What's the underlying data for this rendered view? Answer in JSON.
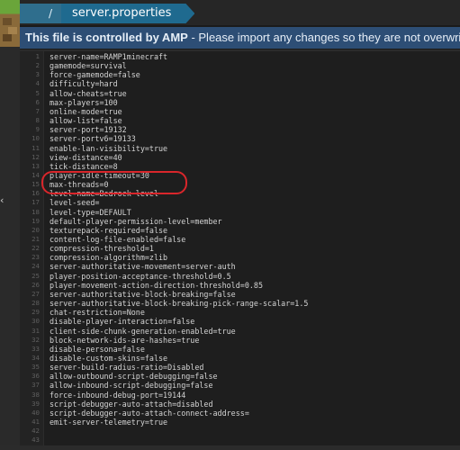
{
  "breadcrumb": {
    "separator": "/",
    "current": "server.properties"
  },
  "banner": {
    "bold_text": "This file is controlled by AMP",
    "rest_text": " - Please import any changes so they are not overwritten by AMP."
  },
  "editor": {
    "lines": [
      {
        "num": "1",
        "text": "server-name=RAMP1minecraft"
      },
      {
        "num": "2",
        "text": "gamemode=survival"
      },
      {
        "num": "3",
        "text": "force-gamemode=false"
      },
      {
        "num": "4",
        "text": "difficulty=hard"
      },
      {
        "num": "5",
        "text": "allow-cheats=true"
      },
      {
        "num": "6",
        "text": "max-players=100"
      },
      {
        "num": "7",
        "text": "online-mode=true"
      },
      {
        "num": "8",
        "text": "allow-list=false"
      },
      {
        "num": "9",
        "text": "server-port=19132"
      },
      {
        "num": "10",
        "text": "server-portv6=19133"
      },
      {
        "num": "11",
        "text": "enable-lan-visibility=true"
      },
      {
        "num": "12",
        "text": "view-distance=40"
      },
      {
        "num": "13",
        "text": "tick-distance=8"
      },
      {
        "num": "14",
        "text": "player-idle-timeout=30"
      },
      {
        "num": "15",
        "text": "max-threads=0"
      },
      {
        "num": "16",
        "text": "level-name=Bedrock level"
      },
      {
        "num": "17",
        "text": "level-seed="
      },
      {
        "num": "18",
        "text": "level-type=DEFAULT"
      },
      {
        "num": "19",
        "text": "default-player-permission-level=member"
      },
      {
        "num": "20",
        "text": "texturepack-required=false"
      },
      {
        "num": "21",
        "text": "content-log-file-enabled=false"
      },
      {
        "num": "22",
        "text": "compression-threshold=1"
      },
      {
        "num": "23",
        "text": "compression-algorithm=zlib"
      },
      {
        "num": "24",
        "text": "server-authoritative-movement=server-auth"
      },
      {
        "num": "25",
        "text": "player-position-acceptance-threshold=0.5"
      },
      {
        "num": "26",
        "text": "player-movement-action-direction-threshold=0.85"
      },
      {
        "num": "27",
        "text": "server-authoritative-block-breaking=false"
      },
      {
        "num": "28",
        "text": "server-authoritative-block-breaking-pick-range-scalar=1.5"
      },
      {
        "num": "29",
        "text": "chat-restriction=None"
      },
      {
        "num": "30",
        "text": "disable-player-interaction=false"
      },
      {
        "num": "31",
        "text": "client-side-chunk-generation-enabled=true"
      },
      {
        "num": "32",
        "text": "block-network-ids-are-hashes=true"
      },
      {
        "num": "33",
        "text": "disable-persona=false"
      },
      {
        "num": "34",
        "text": "disable-custom-skins=false"
      },
      {
        "num": "35",
        "text": "server-build-radius-ratio=Disabled"
      },
      {
        "num": "36",
        "text": "allow-outbound-script-debugging=false"
      },
      {
        "num": "37",
        "text": "allow-inbound-script-debugging=false"
      },
      {
        "num": "38",
        "text": "force-inbound-debug-port=19144"
      },
      {
        "num": "39",
        "text": "script-debugger-auto-attach=disabled"
      },
      {
        "num": "40",
        "text": "script-debugger-auto-attach-connect-address="
      },
      {
        "num": "41",
        "text": "emit-server-telemetry=true"
      },
      {
        "num": "42",
        "text": ""
      },
      {
        "num": "43",
        "text": ""
      }
    ]
  },
  "colors": {
    "banner_bg": "#2d4e75",
    "crumb_bg": "#1f6a8f",
    "highlight_oval": "#d9262b"
  },
  "icons": {
    "app": "minecraft-block-icon",
    "collapse": "chevron-left-icon"
  }
}
